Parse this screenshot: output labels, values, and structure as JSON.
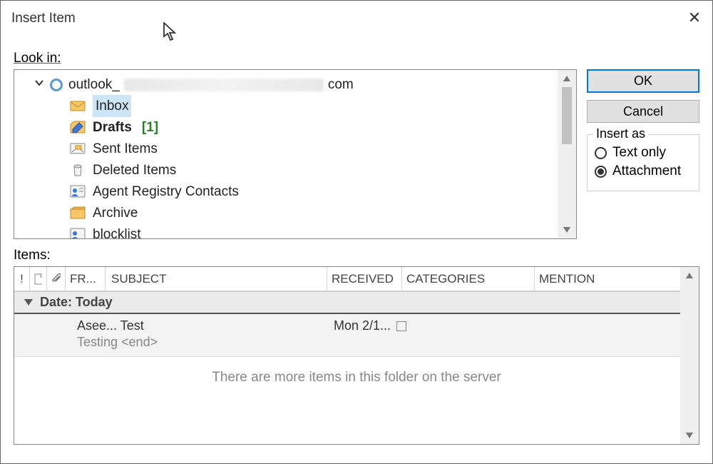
{
  "dialog": {
    "title": "Insert Item"
  },
  "lookin": {
    "label": "Look in:"
  },
  "account": {
    "prefix": "outlook_",
    "suffix": "com"
  },
  "folders": {
    "inbox": "Inbox",
    "drafts": "Drafts",
    "drafts_count": "[1]",
    "sent": "Sent Items",
    "deleted": "Deleted Items",
    "agent": "Agent Registry Contacts",
    "archive": "Archive",
    "blocklist": "blocklist"
  },
  "buttons": {
    "ok": "OK",
    "cancel": "Cancel"
  },
  "insert_as": {
    "title": "Insert as",
    "text_only": "Text only",
    "attachment": "Attachment"
  },
  "items": {
    "label": "Items:"
  },
  "columns": {
    "flag": "!",
    "from": "FR...",
    "subject": "SUBJECT",
    "received": "RECEIVED",
    "categories": "CATEGORIES",
    "mention": "MENTION"
  },
  "group_header": "Date: Today",
  "message": {
    "from_subject": "Asee... Test",
    "preview": "Testing <end>",
    "received": "Mon 2/1..."
  },
  "more_items": "There are more items in this folder on the server"
}
